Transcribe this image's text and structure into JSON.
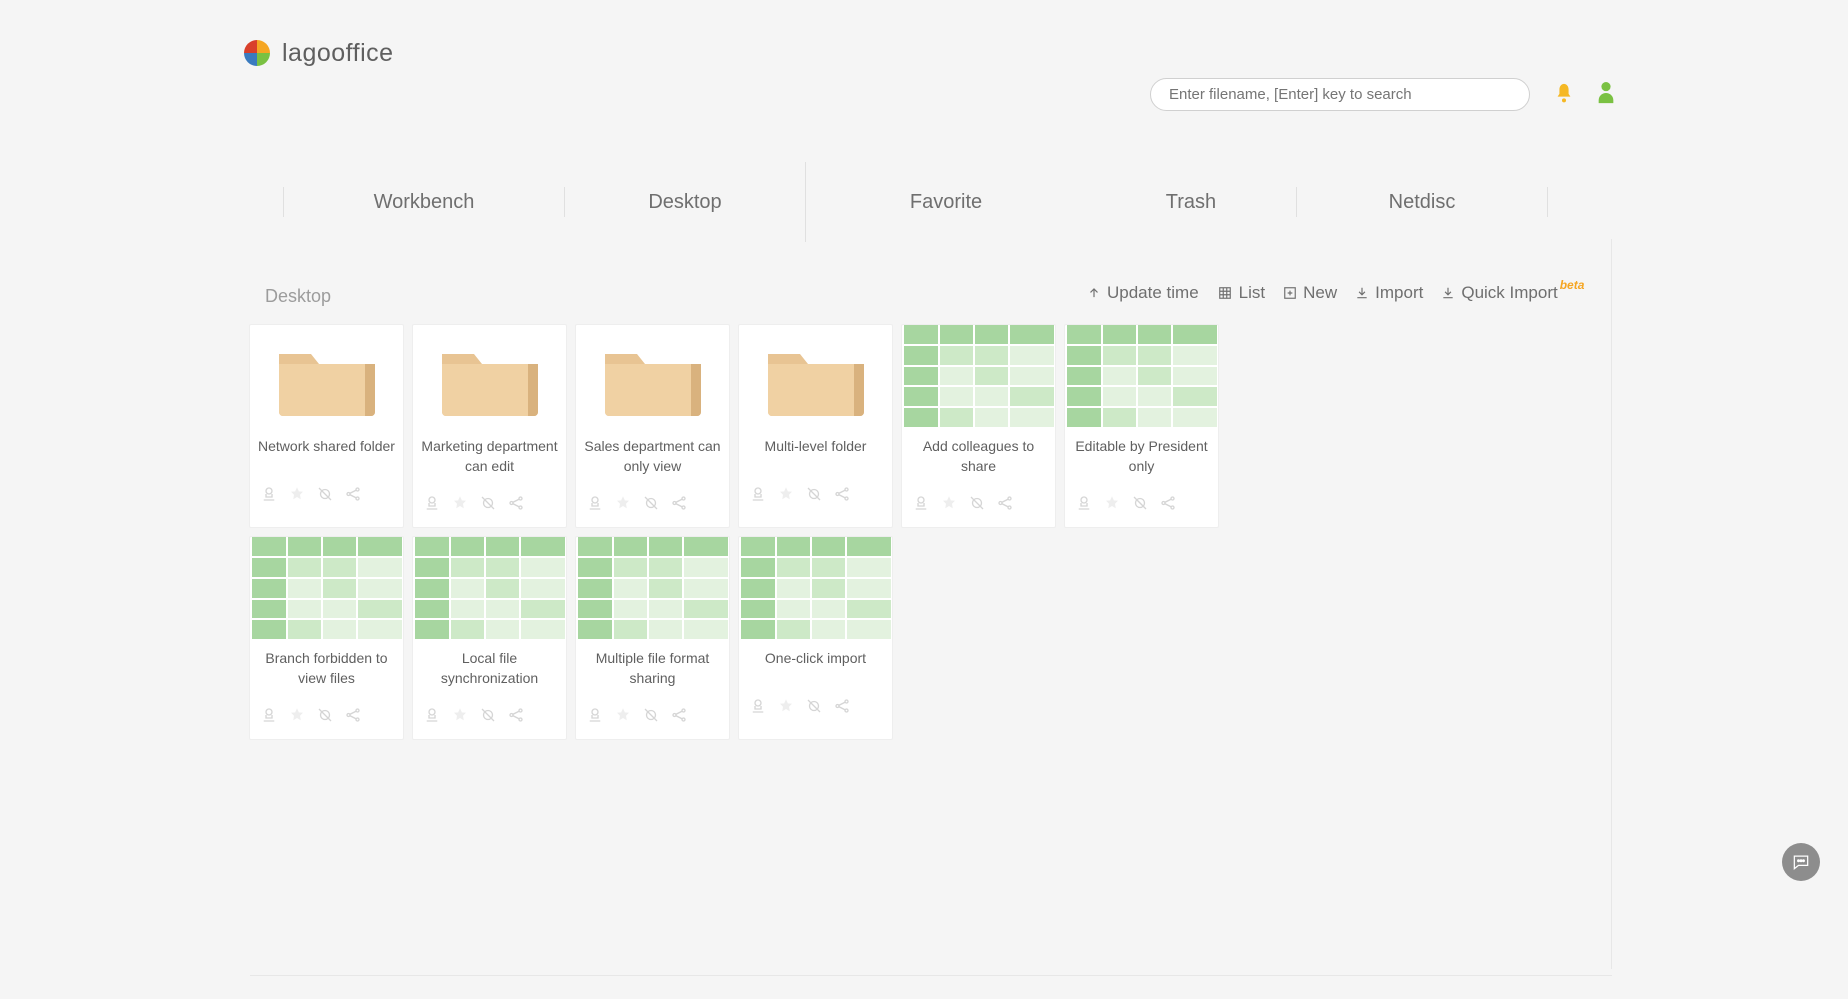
{
  "brand": "lagooffice",
  "search": {
    "placeholder": "Enter filename, [Enter] key to search"
  },
  "tabs": [
    "Workbench",
    "Desktop",
    "Favorite",
    "Trash",
    "Netdisc"
  ],
  "breadcrumb": "Desktop",
  "toolbar": {
    "sort": "Update time",
    "list": "List",
    "new": "New",
    "import": "Import",
    "quick_import": "Quick Import",
    "beta": "beta"
  },
  "items": [
    {
      "type": "folder",
      "label": "Network shared folder"
    },
    {
      "type": "folder",
      "label": "Marketing department can edit"
    },
    {
      "type": "folder",
      "label": "Sales department can only view"
    },
    {
      "type": "folder",
      "label": "Multi-level folder"
    },
    {
      "type": "sheet",
      "label": "Add colleagues to share"
    },
    {
      "type": "sheet",
      "label": "Editable by President only"
    },
    {
      "type": "sheet",
      "label": "Branch forbidden to view files"
    },
    {
      "type": "sheet",
      "label": "Local file synchronization"
    },
    {
      "type": "sheet",
      "label": "Multiple file format sharing"
    },
    {
      "type": "sheet",
      "label": "One-click import"
    }
  ]
}
